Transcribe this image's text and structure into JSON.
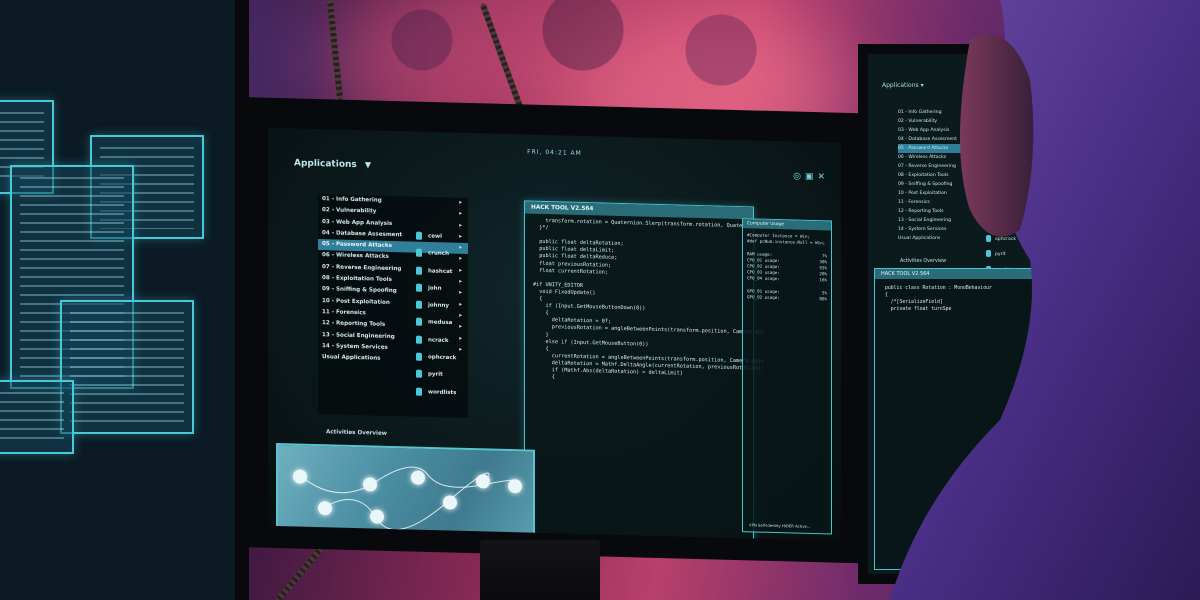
{
  "screen": {
    "clock": "FRI, 04:21 AM",
    "applications_title": "Applications",
    "menu_items": [
      "01 - Info Gathering",
      "02 - Vulnerability",
      "03 - Web App Analysis",
      "04 - Database Assesment",
      "05 - Password Attacks",
      "06 - Wireless Attacks",
      "07 - Reverse Engineering",
      "08 - Exploitation Tools",
      "09 - Sniffing & Spoofing",
      "10 - Post Exploitation",
      "11 - Forensics",
      "12 - Reporting Tools",
      "13 - Social Engineering",
      "14 - System Services",
      "Usual Applications"
    ],
    "selected_menu_index": 4,
    "tools": [
      "cewl",
      "crunch",
      "hashcat",
      "john",
      "johnny",
      "medusa",
      "ncrack",
      "ophcrack",
      "pyrit",
      "wordlists"
    ],
    "activities_overview": "Activities Overview",
    "hack_tool_title": "HACK TOOL V2.564",
    "code_lines": [
      "    transform.rotation = Quaternion.Slerp(transform.rotation, Quaternion.Euler(",
      "  }*/",
      "",
      "  public float deltaRotation;",
      "  public float deltaLimit;",
      "  public float deltaReduce;",
      "  float previousRotation;",
      "  float currentRotation;",
      "",
      "#if UNITY_EDITOR",
      "  void FixedUpdate()",
      "  {",
      "    if (Input.GetMouseButtonDown(0))",
      "    {",
      "      deltaRotation = 0f;",
      "      previousRotation = angleBetweenPoints(transform.position, Camera.mai",
      "    }",
      "    else if (Input.GetMouseButton(0))",
      "    {",
      "      currentRotation = angleBetweenPoints(transform.position, Camera.main",
      "      deltaRotation = Mathf.DeltaAngle(currentRotation, previousRotation);",
      "      if (Mathf.Abs(deltaRotation) > deltaLimit)",
      "      {"
    ],
    "usage_title": "Computer Usage",
    "usage_intro": [
      "#Computer Instance = Win;",
      "#def pcNum.instance.Null = Win;"
    ],
    "usage_rows": [
      {
        "label": "RAM usage:",
        "value": "7%"
      },
      {
        "label": "CPU_01 usage:",
        "value": "30%"
      },
      {
        "label": "CPU_02 usage:",
        "value": "55%"
      },
      {
        "label": "CPU_03 usage:",
        "value": "20%"
      },
      {
        "label": "CPU_04 usage:",
        "value": "16%"
      },
      {
        "label": "",
        "value": ""
      },
      {
        "label": "GPU_01 usage:",
        "value": "5%"
      },
      {
        "label": "GPU_02 usage:",
        "value": "86%"
      }
    ],
    "usage_footer": "VPN Self-Identity HIDER Active..."
  },
  "right_screen": {
    "applications_title": "Applications",
    "activities_overview": "Activities Overview",
    "hack_tool_title": "HACK TOOL V2.564",
    "code_lines": [
      "public class Rotation : MonoBehaviour",
      "{",
      "  /*[SerializeField]",
      "  private float turnSpe"
    ]
  },
  "icon_names": [
    "chevron-down-icon",
    "chevron-right-icon",
    "tool-icon",
    "globe-icon",
    "minimize-icon",
    "close-icon"
  ]
}
